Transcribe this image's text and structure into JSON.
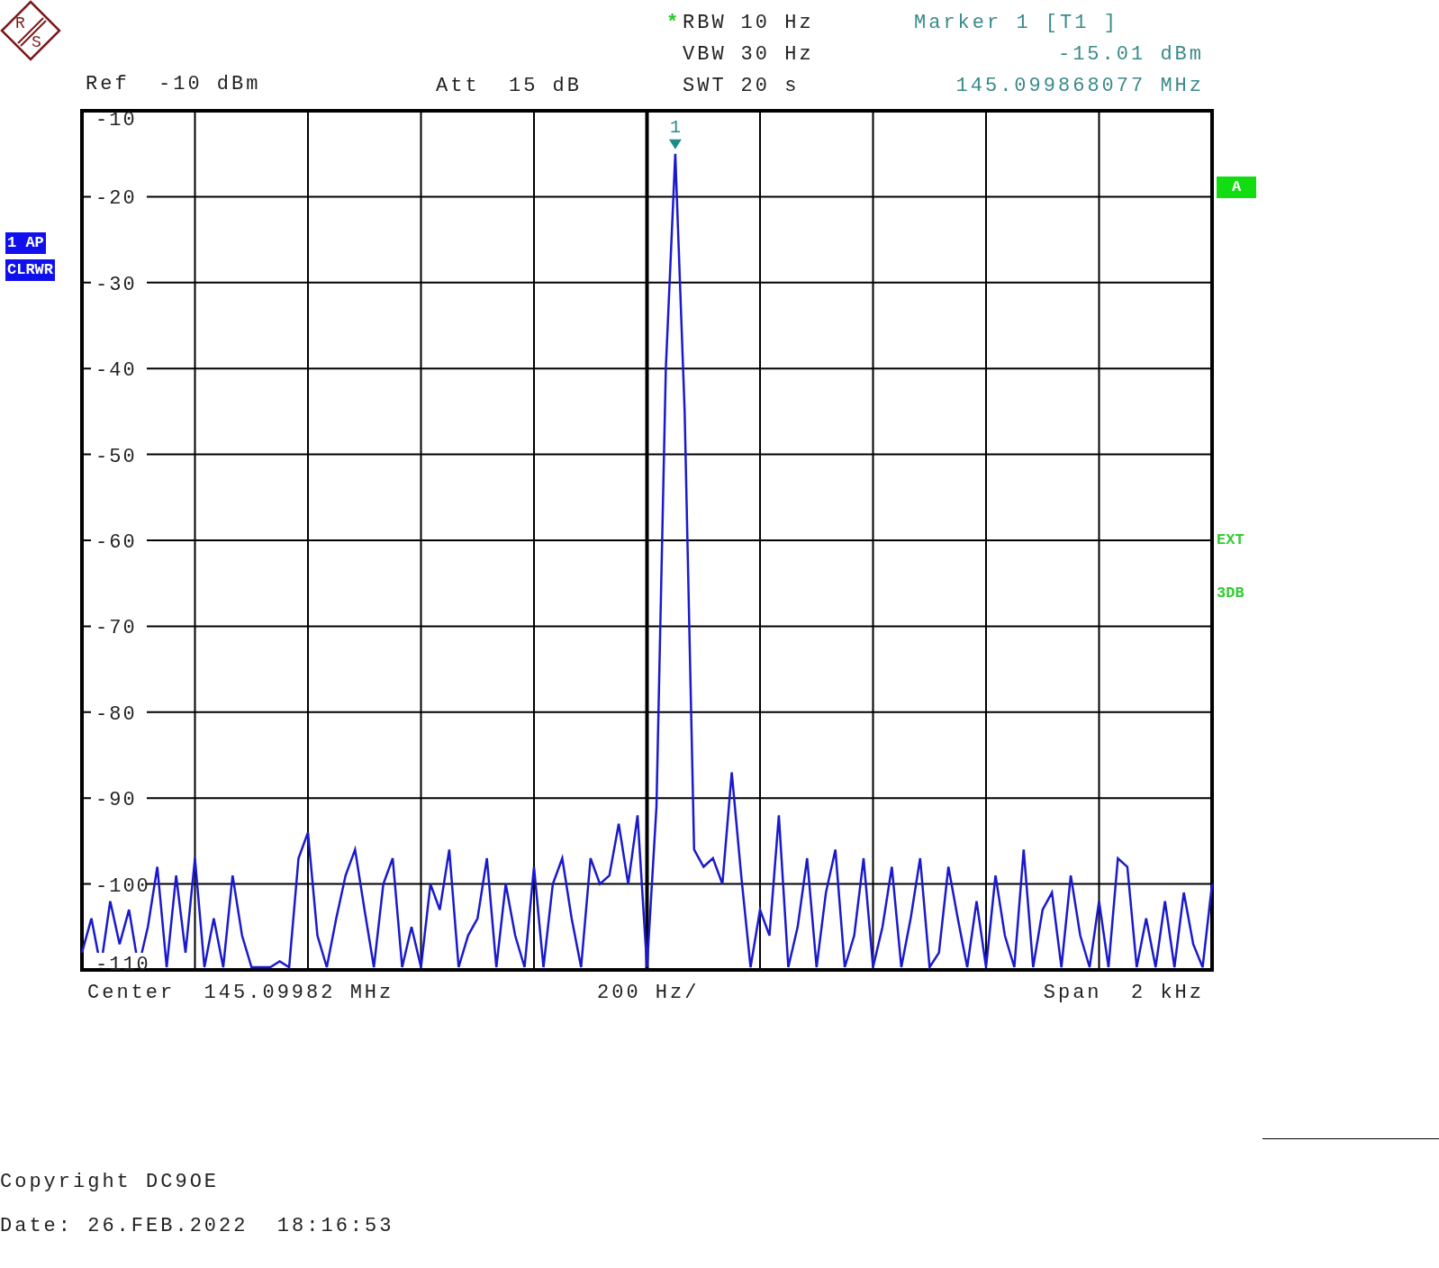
{
  "logo": {
    "letters": [
      "R",
      "S"
    ]
  },
  "header": {
    "ref": "Ref  -10 dBm",
    "att": "Att  15 dB",
    "bandwidth": [
      {
        "mark": "*",
        "label": "RBW",
        "value": "10 Hz"
      },
      {
        "label": "VBW",
        "value": "30 Hz"
      },
      {
        "label": "SWT",
        "value": "20 s"
      }
    ],
    "marker": {
      "title": "Marker 1 [T1 ]",
      "level": "-15.01 dBm",
      "frequency": "145.099868077 MHz"
    }
  },
  "trace_labels": [
    "CLRWR"
  ],
  "side_labels": [
    {
      "text": "A",
      "kind": "badge"
    },
    {
      "text": "EXT",
      "kind": "plain"
    },
    {
      "text": "3DB",
      "kind": "plain"
    }
  ],
  "chart": {
    "chart_data": {
      "type": "line",
      "grid": true,
      "categories": [
        null,
        null,
        null,
        null,
        null,
        null,
        null,
        null,
        null,
        null,
        null,
        null,
        null,
        null,
        null,
        null,
        null,
        null,
        null,
        null,
        null,
        null,
        null,
        null,
        null,
        null,
        null,
        null,
        null,
        null,
        null,
        null,
        null,
        null,
        null,
        null,
        null,
        null,
        null,
        null,
        null,
        null,
        null,
        null,
        null,
        null,
        null,
        null,
        null,
        null,
        null,
        null,
        null,
        null,
        null,
        null,
        null,
        null,
        null,
        null,
        null,
        null,
        null,
        null,
        null,
        null,
        null,
        null,
        null,
        null,
        null,
        null,
        null,
        null,
        null,
        null,
        null,
        null,
        null,
        null,
        null,
        null,
        null,
        null,
        null,
        null,
        null,
        null,
        null,
        null,
        null,
        null,
        null,
        null,
        null,
        null,
        null,
        null,
        null,
        null,
        null,
        null,
        null,
        null,
        null,
        null,
        null,
        null,
        null,
        null,
        null,
        null,
        null,
        null,
        null,
        null,
        null,
        null,
        null,
        null,
        null
      ],
      "ylim": [
        -110,
        -10
      ],
      "yticks": [
        -10,
        -20,
        -30,
        -40,
        -50,
        -60,
        -70,
        -80,
        -90,
        -100,
        -110
      ],
      "series": [
        {
          "name": "1 AP",
          "color": "#1a1acc",
          "values": [
            -108,
            -104,
            -110,
            -102,
            -107,
            -103,
            -110,
            -105,
            -98,
            -110,
            -99,
            -108,
            -97,
            -110,
            -104,
            -110,
            -99,
            -106,
            -110,
            -110,
            -110,
            -109,
            -110,
            -97,
            -94,
            -106,
            -110,
            -104,
            -99,
            -96,
            -103,
            -110,
            -100,
            -97,
            -110,
            -105,
            -110,
            -100,
            -103,
            -96,
            -110,
            -106,
            -104,
            -97,
            -110,
            -100,
            -106,
            -110,
            -98,
            -110,
            -100,
            -97,
            -104,
            -110,
            -97,
            -100,
            -99,
            -93,
            -100,
            -92,
            -110,
            -91,
            -40,
            -15,
            -45,
            -96,
            -98,
            -97,
            -100,
            -87,
            -99,
            -110,
            -103,
            -106,
            -92,
            -110,
            -105,
            -97,
            -110,
            -101,
            -96,
            -110,
            -106,
            -97,
            -110,
            -105,
            -98,
            -110,
            -104,
            -97,
            -110,
            -108,
            -98,
            -104,
            -110,
            -102,
            -110,
            -99,
            -106,
            -110,
            -96,
            -110,
            -103,
            -101,
            -110,
            -99,
            -106,
            -110,
            -102,
            -110,
            -97,
            -98,
            -110,
            -104,
            -110,
            -102,
            -110,
            -101,
            -107,
            -110,
            -100
          ]
        }
      ],
      "annotations": [
        {
          "y": -15.01,
          "text": "1"
        }
      ]
    }
  },
  "footer": {
    "center": "Center  145.09982 MHz",
    "division": "200 Hz/",
    "span": "Span  2 kHz"
  },
  "copyright": "Copyright DC9OE",
  "date": "Date: 26.FEB.2022  18:16:53"
}
